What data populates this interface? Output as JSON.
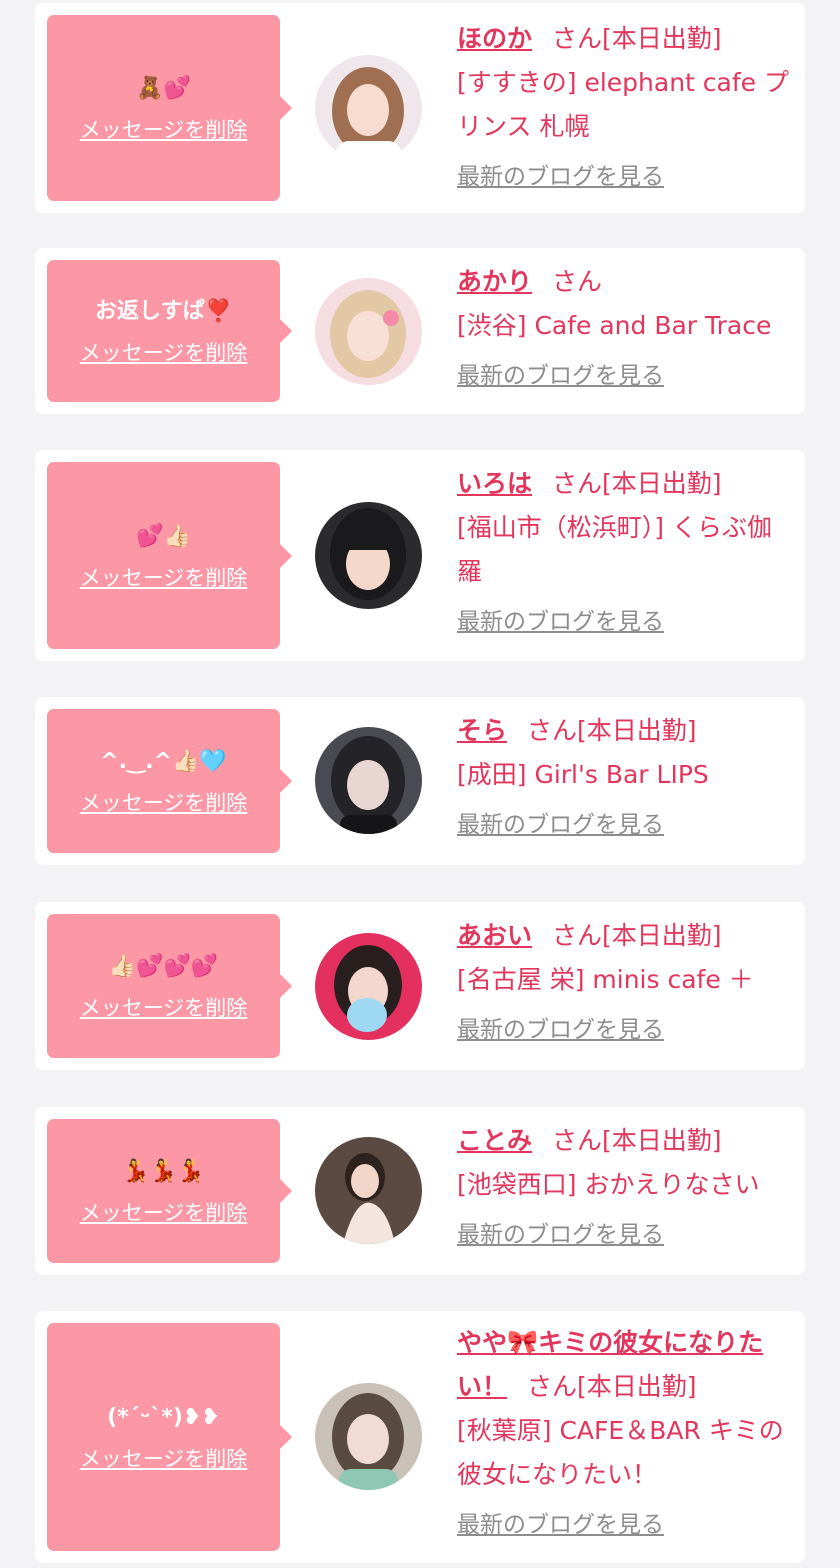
{
  "colors": {
    "page_bg": "#f3f3f5",
    "card_bg": "#ffffff",
    "bubble_bg": "#fc98a5",
    "accent_text": "#e2365d",
    "link_gray": "#8d8d8d"
  },
  "messages": [
    {
      "bubble_text": "🧸💕",
      "delete_label": "メッセージを削除",
      "name": "ほのか",
      "honorific": "さん",
      "status": "[本日出勤]",
      "shop": "[すすきの] elephant cafe プリンス 札幌",
      "blog_label": "最新のブログを見る",
      "avatar_icon": "woman-portrait-icon"
    },
    {
      "bubble_text": "お返しすぱ❣️",
      "delete_label": "メッセージを削除",
      "name": "あかり",
      "honorific": "さん",
      "status": "",
      "shop": "[渋谷] Cafe and Bar Trace",
      "blog_label": "最新のブログを見る",
      "avatar_icon": "woman-portrait-icon"
    },
    {
      "bubble_text": "💕👍🏻",
      "delete_label": "メッセージを削除",
      "name": "いろは",
      "honorific": "さん",
      "status": "[本日出勤]",
      "shop": "[福山市（松浜町）] くらぶ伽羅",
      "blog_label": "最新のブログを見る",
      "avatar_icon": "woman-portrait-icon"
    },
    {
      "bubble_text": "^.‿.^👍🏻🩵",
      "delete_label": "メッセージを削除",
      "name": "そら",
      "honorific": "さん",
      "status": "[本日出勤]",
      "shop": "[成田] Girl's Bar LIPS",
      "blog_label": "最新のブログを見る",
      "avatar_icon": "woman-portrait-icon"
    },
    {
      "bubble_text": "👍🏻💕💕💕",
      "delete_label": "メッセージを削除",
      "name": "あおい",
      "honorific": "さん",
      "status": "[本日出勤]",
      "shop": "[名古屋 栄] minis cafe ＋",
      "blog_label": "最新のブログを見る",
      "avatar_icon": "woman-portrait-icon"
    },
    {
      "bubble_text": "💃💃💃",
      "delete_label": "メッセージを削除",
      "name": "ことみ",
      "honorific": "さん",
      "status": "[本日出勤]",
      "shop": "[池袋西口] おかえりなさい",
      "blog_label": "最新のブログを見る",
      "avatar_icon": "woman-portrait-icon"
    },
    {
      "bubble_text": "(*ˊᵕˋ*)❥❥",
      "delete_label": "メッセージを削除",
      "name": "やや🎀キミの彼女になりたい！",
      "honorific": "さん",
      "status": "[本日出勤]",
      "shop": "[秋葉原] CAFE＆BAR キミの彼女になりたい！",
      "blog_label": "最新のブログを見る",
      "avatar_icon": "woman-portrait-icon"
    }
  ]
}
